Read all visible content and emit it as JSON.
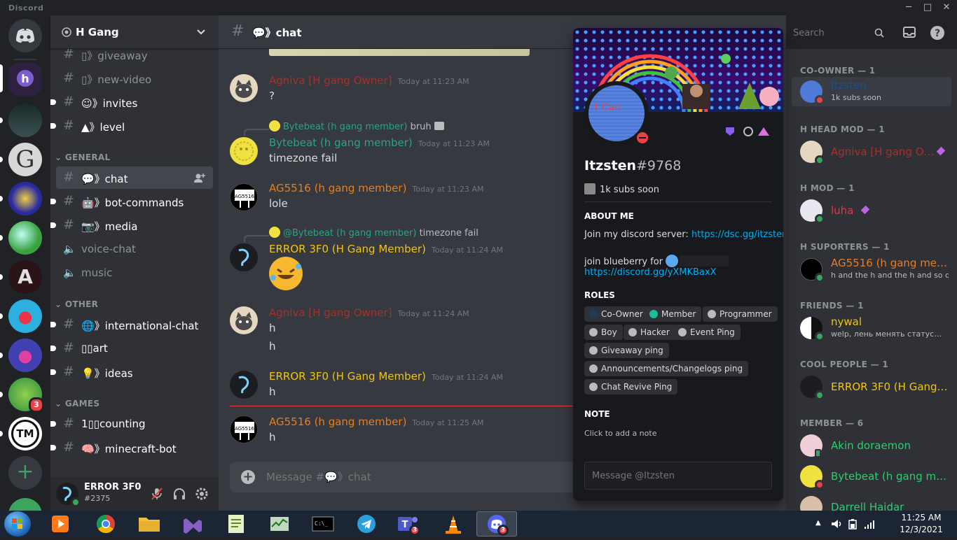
{
  "app": {
    "title": "Discord"
  },
  "window_controls": {
    "minimize": "─",
    "maximize": "□",
    "close": "✕"
  },
  "rail": {
    "servers": [
      {
        "name": "discord-home",
        "color": "#36393f",
        "unread": false
      },
      {
        "name": "h-gang",
        "color": "#3a2a52",
        "unread": false,
        "selected": true
      },
      {
        "name": "server-dark",
        "color": "#2b3a3a",
        "unread": true
      },
      {
        "name": "server-g",
        "color": "#555555",
        "unread": true,
        "glyph": "G"
      },
      {
        "name": "server-cyber",
        "color": "#2a2aa0",
        "unread": true
      },
      {
        "name": "server-cloud",
        "color": "#3aa040",
        "unread": true
      },
      {
        "name": "server-a",
        "color": "#2a1418",
        "unread": true,
        "glyph": "A"
      },
      {
        "name": "server-beast",
        "color": "#2bb0e0",
        "unread": true
      },
      {
        "name": "server-beast2",
        "color": "#4040b0",
        "unread": true
      },
      {
        "name": "server-pepe",
        "color": "#2c8c3c",
        "unread": true,
        "badge": "3"
      },
      {
        "name": "server-tm",
        "color": "#ffffff",
        "unread": true,
        "glyph": "TM"
      }
    ],
    "add_server": "+"
  },
  "guild": {
    "name": "H Gang",
    "chevron": "⌄"
  },
  "channels": {
    "items": [
      {
        "kind": "text",
        "label": "▯》giveaway",
        "state": "muted",
        "y": 0
      },
      {
        "kind": "text",
        "label": "▯》new-video",
        "state": "muted"
      },
      {
        "kind": "text",
        "label": "☺》invites",
        "state": "unread"
      },
      {
        "kind": "text",
        "label": "▲》level",
        "state": "unread"
      }
    ],
    "categories": {
      "general": "GENERAL",
      "other": "OTHER",
      "games": "GAMES"
    },
    "general": [
      {
        "kind": "text",
        "label": "💬》chat",
        "state": "active"
      },
      {
        "kind": "text",
        "label": "🤖》bot-commands",
        "state": "unread"
      },
      {
        "kind": "text",
        "label": "📷》media",
        "state": "unread"
      },
      {
        "kind": "voice",
        "label": "voice-chat",
        "state": "muted"
      },
      {
        "kind": "voice",
        "label": "music",
        "state": "muted"
      }
    ],
    "other": [
      {
        "kind": "text",
        "label": "🌐》international-chat",
        "state": "unread"
      },
      {
        "kind": "text",
        "label": "▯▯art",
        "state": "unread"
      },
      {
        "kind": "text",
        "label": "💡》ideas",
        "state": "unread"
      }
    ],
    "games": [
      {
        "kind": "text",
        "label": "1▯▯counting",
        "state": "unread"
      },
      {
        "kind": "text",
        "label": "🧠》minecraft-bot",
        "state": "unread"
      }
    ]
  },
  "user_panel": {
    "username": "ERROR 3F0",
    "tag": "#2375"
  },
  "chat_header": {
    "channel": "💬》chat"
  },
  "messages": [
    {
      "author": "Agniva [H gang Owner]",
      "color": "#a8302a",
      "time": "Today at 11:23 AM",
      "lines": [
        "?"
      ]
    },
    {
      "reply_author": "Bytebeat (h gang member)",
      "reply_text": "bruh",
      "reply_color": "#2ea37f",
      "author": "Bytebeat (h gang member)",
      "color": "#2ea37f",
      "time": "Today at 11:23 AM",
      "lines": [
        "timezone fail"
      ]
    },
    {
      "author": "AG5516 (h gang member)",
      "color": "#e67e22",
      "time": "Today at 11:23 AM",
      "lines": [
        "lole"
      ]
    },
    {
      "reply_author": "@Bytebeat (h gang member)",
      "reply_text": "timezone fail",
      "reply_color": "#2ea37f",
      "author": "ERROR 3F0 (H Gang Member)",
      "color": "#f1c40f",
      "time": "Today at 11:24 AM",
      "lines": [
        "🤣"
      ]
    },
    {
      "author": "Agniva [H gang Owner]",
      "color": "#a8302a",
      "time": "Today at 11:24 AM",
      "lines": [
        "h",
        "h"
      ]
    },
    {
      "author": "ERROR 3F0 (H Gang Member)",
      "color": "#f1c40f",
      "time": "Today at 11:24 AM",
      "lines": [
        "h"
      ]
    },
    {
      "author": "AG5516 (h gang member)",
      "color": "#e67e22",
      "time": "Today at 11:25 AM",
      "lines": [
        "h"
      ]
    }
  ],
  "composer": {
    "placeholder": "Message #💬》chat"
  },
  "search": {
    "placeholder": "Search"
  },
  "profile": {
    "name": "Itzsten",
    "discriminator": "#9768",
    "custom_status": "1k subs soon",
    "about_heading": "ABOUT ME",
    "about_line1": "Join my discord server: ",
    "about_link1": "https://dsc.gg/itzsten",
    "about_line2": "join blueberry for",
    "about_link2": "https://discord.gg/yXMKBaxX",
    "roles_heading": "ROLES",
    "roles": [
      {
        "name": "Co-Owner",
        "color": "#1f3a5a"
      },
      {
        "name": "Member",
        "color": "#1abc9c"
      },
      {
        "name": "Programmer",
        "color": "#b9bbbe"
      },
      {
        "name": "Boy",
        "color": "#b9bbbe"
      },
      {
        "name": "Hacker",
        "color": "#b9bbbe"
      },
      {
        "name": "Event Ping",
        "color": "#b9bbbe"
      },
      {
        "name": "Giveaway ping",
        "color": "#b9bbbe"
      },
      {
        "name": "Announcements/Changelogs ping",
        "color": "#b9bbbe"
      },
      {
        "name": "Chat Revive Ping",
        "color": "#b9bbbe"
      }
    ],
    "note_heading": "NOTE",
    "note_placeholder": "Click to add a note",
    "message_placeholder": "Message @Itzsten"
  },
  "members": {
    "groups": [
      {
        "title": "CO-OWNER — 1",
        "items": [
          {
            "name": "Itzsten",
            "color": "#1f4f8a",
            "status": "1k subs soon",
            "presence": "dnd"
          }
        ]
      },
      {
        "title": "H HEAD MOD — 1",
        "items": [
          {
            "name": "Agniva [H gang Ow…",
            "color": "#a8302a",
            "presence": "online"
          }
        ]
      },
      {
        "title": "H MOD — 1",
        "items": [
          {
            "name": "luha",
            "color": "#e8354a",
            "presence": "online"
          }
        ]
      },
      {
        "title": "H SUPORTERS — 1",
        "items": [
          {
            "name": "AG5516 (h gang mem…",
            "color": "#e67e22",
            "status": "h and the h and the h and so on",
            "presence": "online"
          }
        ]
      },
      {
        "title": "FRIENDS — 1",
        "items": [
          {
            "name": "nywal",
            "color": "#f1c40f",
            "status": "welp, лень менять статус…",
            "presence": "online"
          }
        ]
      },
      {
        "title": "COOL PEOPLE — 1",
        "items": [
          {
            "name": "ERROR 3F0 (H Gang …",
            "color": "#f1c40f",
            "presence": "online"
          }
        ]
      },
      {
        "title": "MEMBER — 6",
        "items": [
          {
            "name": "Akin doraemon",
            "color": "#2ecc71",
            "presence": "mobile"
          },
          {
            "name": "Bytebeat (h gang mem…",
            "color": "#2ecc71",
            "presence": "dnd"
          },
          {
            "name": "Darrell Haidar",
            "color": "#2ecc71",
            "presence": "online"
          }
        ]
      }
    ]
  },
  "taskbar": {
    "apps": [
      "start-orb",
      "media-player",
      "chrome",
      "file-explorer",
      "visual-studio",
      "notepad-plus-plus",
      "task-manager",
      "command-prompt",
      "telegram",
      "teams",
      "vlc",
      "discord"
    ],
    "teams_badge": "3",
    "discord_badge": "3",
    "time": "11:25 AM",
    "date": "12/3/2021"
  }
}
